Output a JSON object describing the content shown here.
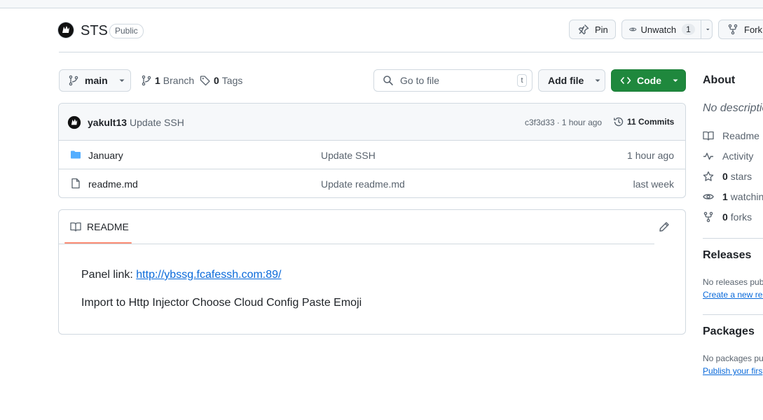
{
  "repo": {
    "name": "STS",
    "visibility": "Public"
  },
  "actions": {
    "pin": "Pin",
    "unwatch": "Unwatch",
    "watch_count": "1",
    "fork": "Fork"
  },
  "toolbar": {
    "branch": "main",
    "branches_count": "1",
    "branches_label": "Branch",
    "tags_count": "0",
    "tags_label": "Tags",
    "search_placeholder": "Go to file",
    "search_shortcut": "t",
    "add_file": "Add file",
    "code": "Code"
  },
  "commit": {
    "author": "yakult13",
    "message": "Update SSH",
    "hash": "c3f3d33",
    "sep": "·",
    "time": "1 hour ago",
    "commits": "11 Commits"
  },
  "files": [
    {
      "name": "January",
      "type": "folder",
      "message": "Update SSH",
      "time": "1 hour ago"
    },
    {
      "name": "readme.md",
      "type": "file",
      "message": "Update readme.md",
      "time": "last week"
    }
  ],
  "readme": {
    "tab": "README",
    "panel_label": "Panel link:",
    "panel_url": "http://ybssg.fcafessh.com:89/",
    "line2": "Import to Http Injector Choose Cloud Config Paste Emoji"
  },
  "about": {
    "title": "About",
    "description": "No descriptio",
    "readme": "Readme",
    "activity": "Activity",
    "stars_count": "0",
    "stars_label": "stars",
    "watching_count": "1",
    "watching_label": "watchin",
    "forks_count": "0",
    "forks_label": "forks"
  },
  "releases": {
    "title": "Releases",
    "empty": "No releases pub",
    "create": "Create a new rel"
  },
  "packages": {
    "title": "Packages",
    "empty": "No packages pu",
    "publish": "Publish your firs"
  },
  "colors": {
    "primary_green": "#1f883d",
    "link_blue": "#0969da",
    "folder_blue": "#54aeff",
    "tab_underline": "#fd8c73"
  },
  "icons": [
    "avatar",
    "pin-icon",
    "eye-icon",
    "repo-forked-icon",
    "git-branch-icon",
    "tag-icon",
    "search-icon",
    "code-icon",
    "history-icon",
    "folder-icon",
    "file-icon",
    "book-icon",
    "pencil-icon",
    "pulse-icon",
    "star-icon",
    "caret-down-icon"
  ]
}
